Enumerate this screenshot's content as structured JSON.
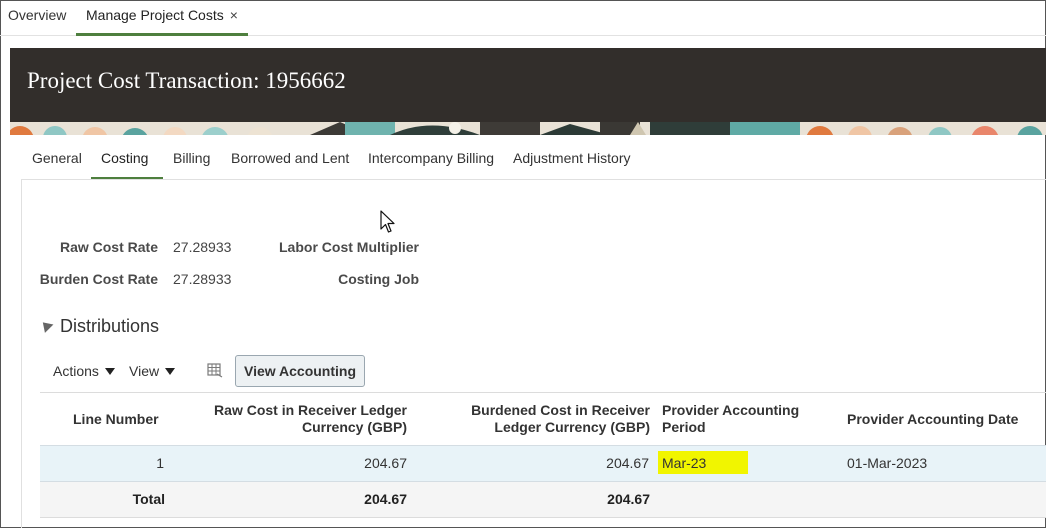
{
  "top_tabs": [
    {
      "label": "Overview"
    },
    {
      "label": "Manage Project Costs",
      "close": "×"
    }
  ],
  "header": {
    "title": "Project Cost Transaction: 1956662"
  },
  "sub_tabs": [
    {
      "label": "General"
    },
    {
      "label": "Costing"
    },
    {
      "label": "Billing"
    },
    {
      "label": "Borrowed and Lent"
    },
    {
      "label": "Intercompany Billing"
    },
    {
      "label": "Adjustment History"
    }
  ],
  "fields": {
    "raw_cost_rate": {
      "label": "Raw Cost Rate",
      "value": "27.28933"
    },
    "burden_cost_rate": {
      "label": "Burden Cost Rate",
      "value": "27.28933"
    },
    "labor_cost_multiplier": {
      "label": "Labor Cost Multiplier",
      "value": ""
    },
    "costing_job": {
      "label": "Costing Job",
      "value": ""
    }
  },
  "distributions": {
    "title": "Distributions",
    "toolbar": {
      "actions": "Actions",
      "view": "View",
      "view_accounting": "View Accounting"
    },
    "columns": {
      "line_number": "Line Number",
      "raw_cost_1": "Raw Cost in Receiver Ledger",
      "raw_cost_2": "Currency (GBP)",
      "burdened_1": "Burdened Cost in Receiver",
      "burdened_2": "Ledger Currency (GBP)",
      "period_1": "Provider Accounting",
      "period_2": "Period",
      "date": "Provider Accounting Date"
    },
    "rows": [
      {
        "line_number": "1",
        "raw_cost": "204.67",
        "burdened_cost": "204.67",
        "period": "Mar-23",
        "date": "01-Mar-2023"
      }
    ],
    "total": {
      "label": "Total",
      "raw_cost": "204.67",
      "burdened_cost": "204.67"
    }
  },
  "colors": {
    "header_bg": "#322e2b",
    "accent": "#4e7f3e",
    "highlight": "#f1f500",
    "selected_row": "#e8f3f8"
  },
  "icons": [
    "close-icon",
    "collapse-triangle-icon",
    "chevron-down-icon",
    "detach-table-icon",
    "mouse-cursor-icon"
  ]
}
